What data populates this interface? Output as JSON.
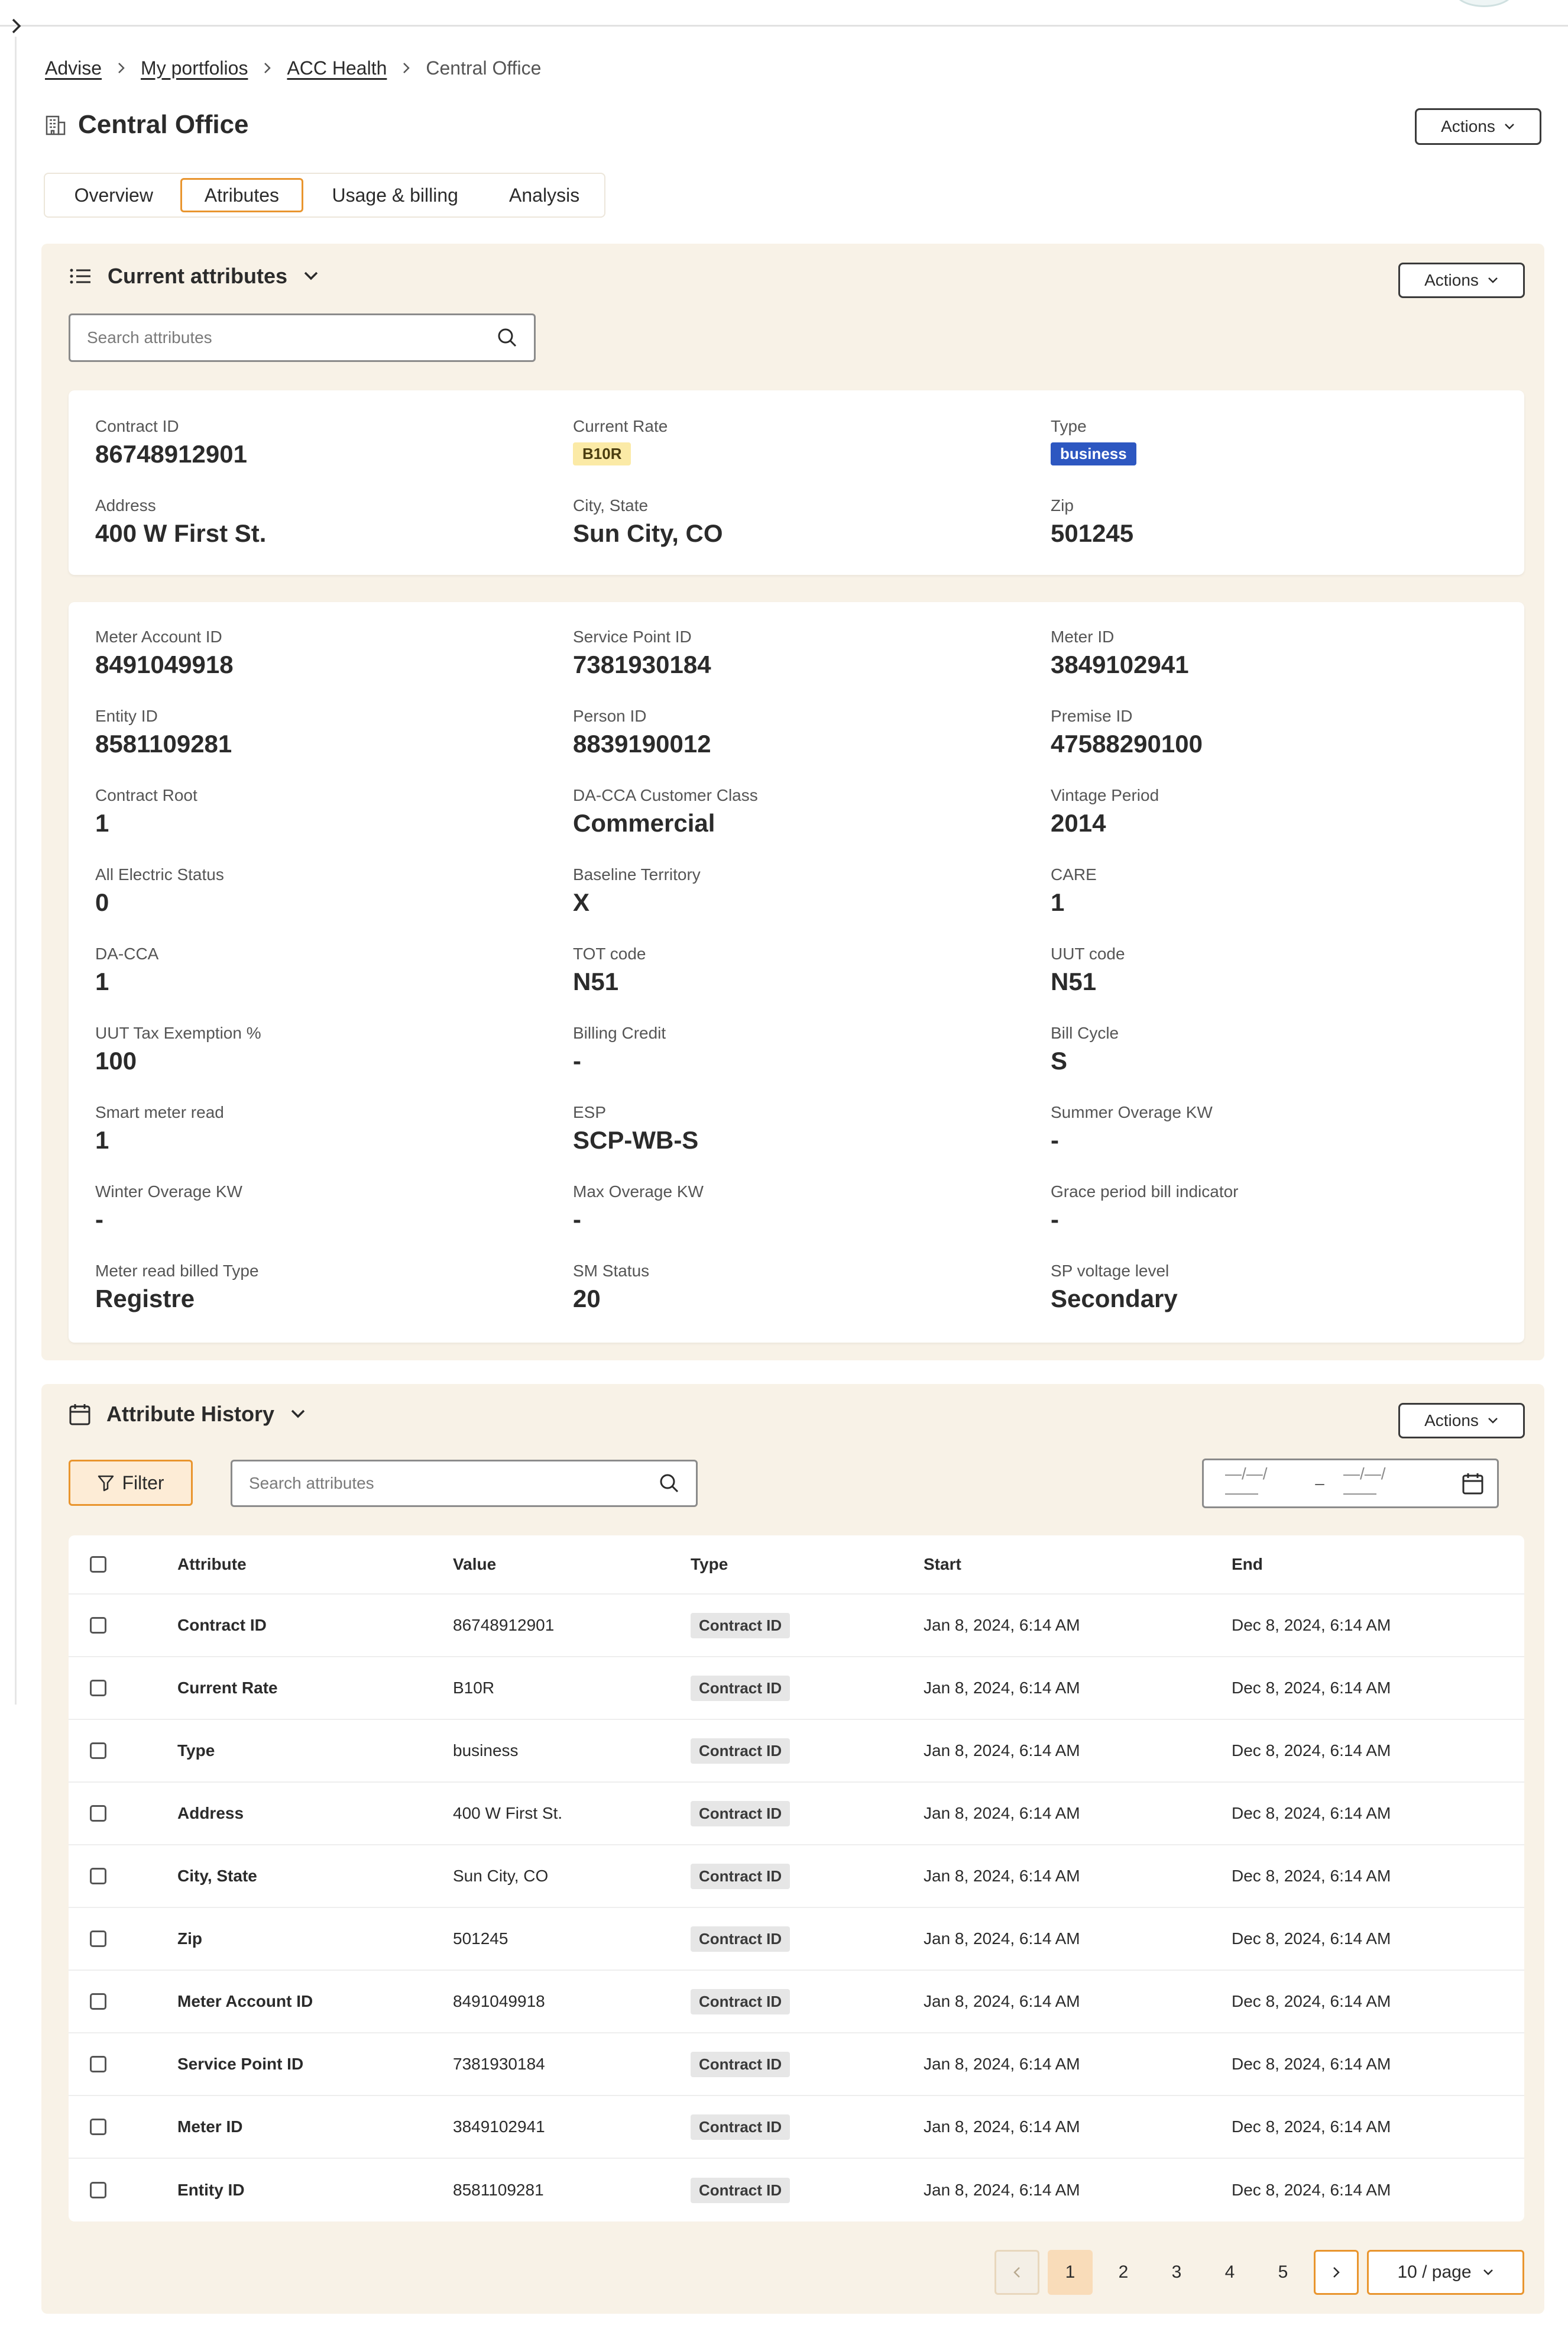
{
  "breadcrumb": {
    "items": [
      "Advise",
      "My portfolios",
      "ACC Health"
    ],
    "current": "Central Office"
  },
  "page": {
    "title": "Central Office",
    "actions_label": "Actions"
  },
  "tabs": [
    {
      "label": "Overview",
      "active": false
    },
    {
      "label": "Atributes",
      "active": true
    },
    {
      "label": "Usage & billing",
      "active": false
    },
    {
      "label": "Analysis",
      "active": false
    }
  ],
  "current_attributes": {
    "title": "Current attributes",
    "actions_label": "Actions",
    "search_placeholder": "Search attributes",
    "summary": [
      {
        "label": "Contract ID",
        "value": "86748912901"
      },
      {
        "label": "Current Rate",
        "tag": "B10R"
      },
      {
        "label": "Type",
        "tag": "business"
      },
      {
        "label": "Address",
        "value": "400 W First St."
      },
      {
        "label": "City, State",
        "value": "Sun City, CO"
      },
      {
        "label": "Zip",
        "value": "501245"
      }
    ],
    "details": [
      {
        "label": "Meter Account ID",
        "value": "8491049918"
      },
      {
        "label": "Service Point ID",
        "value": "7381930184"
      },
      {
        "label": "Meter ID",
        "value": "3849102941"
      },
      {
        "label": "Entity ID",
        "value": "8581109281"
      },
      {
        "label": "Person ID",
        "value": "8839190012"
      },
      {
        "label": "Premise ID",
        "value": "47588290100"
      },
      {
        "label": "Contract Root",
        "value": "1"
      },
      {
        "label": "DA-CCA Customer Class",
        "value": "Commercial"
      },
      {
        "label": "Vintage Period",
        "value": "2014"
      },
      {
        "label": "All Electric Status",
        "value": "0"
      },
      {
        "label": "Baseline Territory",
        "value": "X"
      },
      {
        "label": "CARE",
        "value": "1"
      },
      {
        "label": "DA-CCA",
        "value": "1"
      },
      {
        "label": "TOT code",
        "value": "N51"
      },
      {
        "label": "UUT code",
        "value": "N51"
      },
      {
        "label": "UUT Tax Exemption %",
        "value": "100"
      },
      {
        "label": "Billing Credit",
        "value": "-"
      },
      {
        "label": "Bill Cycle",
        "value": "S"
      },
      {
        "label": "Smart meter read",
        "value": "1"
      },
      {
        "label": "ESP",
        "value": "SCP-WB-S"
      },
      {
        "label": "Summer Overage KW",
        "value": "-"
      },
      {
        "label": "Winter Overage KW",
        "value": "-"
      },
      {
        "label": "Max Overage KW",
        "value": "-"
      },
      {
        "label": "Grace period bill indicator",
        "value": "-"
      },
      {
        "label": "Meter read billed Type",
        "value": "Registre"
      },
      {
        "label": "SM Status",
        "value": "20"
      },
      {
        "label": "SP voltage level",
        "value": "Secondary"
      }
    ]
  },
  "attribute_history": {
    "title": "Attribute History",
    "actions_label": "Actions",
    "filter_label": "Filter",
    "search_placeholder": "Search attributes",
    "date_placeholder": "—/—/——",
    "date_separator": "–",
    "columns": [
      "Attribute",
      "Value",
      "Type",
      "Start",
      "End"
    ],
    "rows": [
      {
        "attribute": "Contract ID",
        "value": "86748912901",
        "type": "Contract ID",
        "start": "Jan 8, 2024, 6:14 AM",
        "end": "Dec 8, 2024, 6:14 AM"
      },
      {
        "attribute": "Current Rate",
        "value": "B10R",
        "type": "Contract ID",
        "start": "Jan 8, 2024, 6:14 AM",
        "end": "Dec 8, 2024, 6:14 AM"
      },
      {
        "attribute": "Type",
        "value": "business",
        "type": "Contract ID",
        "start": "Jan 8, 2024, 6:14 AM",
        "end": "Dec 8, 2024, 6:14 AM"
      },
      {
        "attribute": "Address",
        "value": "400 W First St.",
        "type": "Contract ID",
        "start": "Jan 8, 2024, 6:14 AM",
        "end": "Dec 8, 2024, 6:14 AM"
      },
      {
        "attribute": "City, State",
        "value": "Sun City, CO",
        "type": "Contract ID",
        "start": "Jan 8, 2024, 6:14 AM",
        "end": "Dec 8, 2024, 6:14 AM"
      },
      {
        "attribute": "Zip",
        "value": "501245",
        "type": "Contract ID",
        "start": "Jan 8, 2024, 6:14 AM",
        "end": "Dec 8, 2024, 6:14 AM"
      },
      {
        "attribute": "Meter Account ID",
        "value": "8491049918",
        "type": "Contract ID",
        "start": "Jan 8, 2024, 6:14 AM",
        "end": "Dec 8, 2024, 6:14 AM"
      },
      {
        "attribute": "Service Point ID",
        "value": "7381930184",
        "type": "Contract ID",
        "start": "Jan 8, 2024, 6:14 AM",
        "end": "Dec 8, 2024, 6:14 AM"
      },
      {
        "attribute": "Meter ID",
        "value": "3849102941",
        "type": "Contract ID",
        "start": "Jan 8, 2024, 6:14 AM",
        "end": "Dec 8, 2024, 6:14 AM"
      },
      {
        "attribute": "Entity ID",
        "value": "8581109281",
        "type": "Contract ID",
        "start": "Jan 8, 2024, 6:14 AM",
        "end": "Dec 8, 2024, 6:14 AM"
      }
    ],
    "pagination": {
      "pages": [
        "1",
        "2",
        "3",
        "4",
        "5"
      ],
      "current": "1",
      "page_size_label": "10 / page"
    }
  },
  "icons": {
    "expand": "chevron-right-icon",
    "building": "building-icon",
    "list": "list-icon",
    "calendar": "calendar-icon",
    "search": "search-icon",
    "filter": "filter-icon"
  },
  "colors": {
    "accent": "#e9952e",
    "panel_bg": "#f8f2e7",
    "business_tag": "#2d57c1",
    "rate_tag": "#fbeaa6"
  }
}
